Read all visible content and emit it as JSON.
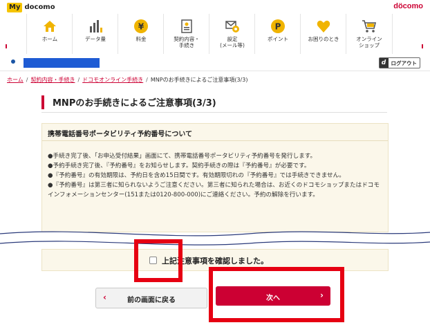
{
  "header": {
    "my_badge": "My",
    "my_text": "docomo",
    "brand": "döcomo"
  },
  "nav": {
    "items": [
      {
        "label": "ホーム",
        "icon": "house-icon"
      },
      {
        "label": "データ量",
        "icon": "bar-chart-icon"
      },
      {
        "label": "料金",
        "icon": "yen-coin-icon"
      },
      {
        "label": "契約内容・\n手続き",
        "icon": "contract-icon"
      },
      {
        "label": "設定\n(メール等)",
        "icon": "settings-mail-icon"
      },
      {
        "label": "ポイント",
        "icon": "point-icon"
      },
      {
        "label": "お困りのとき",
        "icon": "heart-icon"
      },
      {
        "label": "オンライン\nショップ",
        "icon": "cart-icon"
      }
    ]
  },
  "userbar": {
    "logout_mark": "d",
    "logout_label": "ログアウト"
  },
  "breadcrumb": {
    "home": "ホーム",
    "contract": "契約内容・手続き",
    "online": "ドコモオンライン手続き",
    "current": "MNPのお手続きによるご注意事項(3/3)"
  },
  "page": {
    "title": "MNPのお手続きによるご注意事項(3/3)"
  },
  "notice": {
    "heading": "携帯電話番号ポータビリティ予約番号について",
    "lines": [
      "●手続き完了後、「お申込受付結果」画面にて、携帯電話番号ポータビリティ予約番号を発行します。",
      "●予約手続き完了後、『予約番号』をお知らせします。契約手続きの際は『予約番号』が必要です。",
      "●『予約番号』の有効期限は、予約日を含め15日間です。有効期限切れの『予約番号』では手続きできません。",
      "●『予約番号』は第三者に知られないようご注意ください。第三者に知られた場合は、お近くのドコモショップまたはドコモインフォメーションセンター(151または0120-800-000)にご連絡ください。予約の解除を行います。"
    ]
  },
  "confirm": {
    "label": "上記注意事項を確認しました。"
  },
  "buttons": {
    "back_label": "前の画面に戻る",
    "back_arrow": "‹",
    "next_label": "次へ",
    "next_arrow": "›"
  },
  "colors": {
    "accent": "#cc0033",
    "highlight": "#e60012",
    "user_block": "#1e5bd4"
  }
}
